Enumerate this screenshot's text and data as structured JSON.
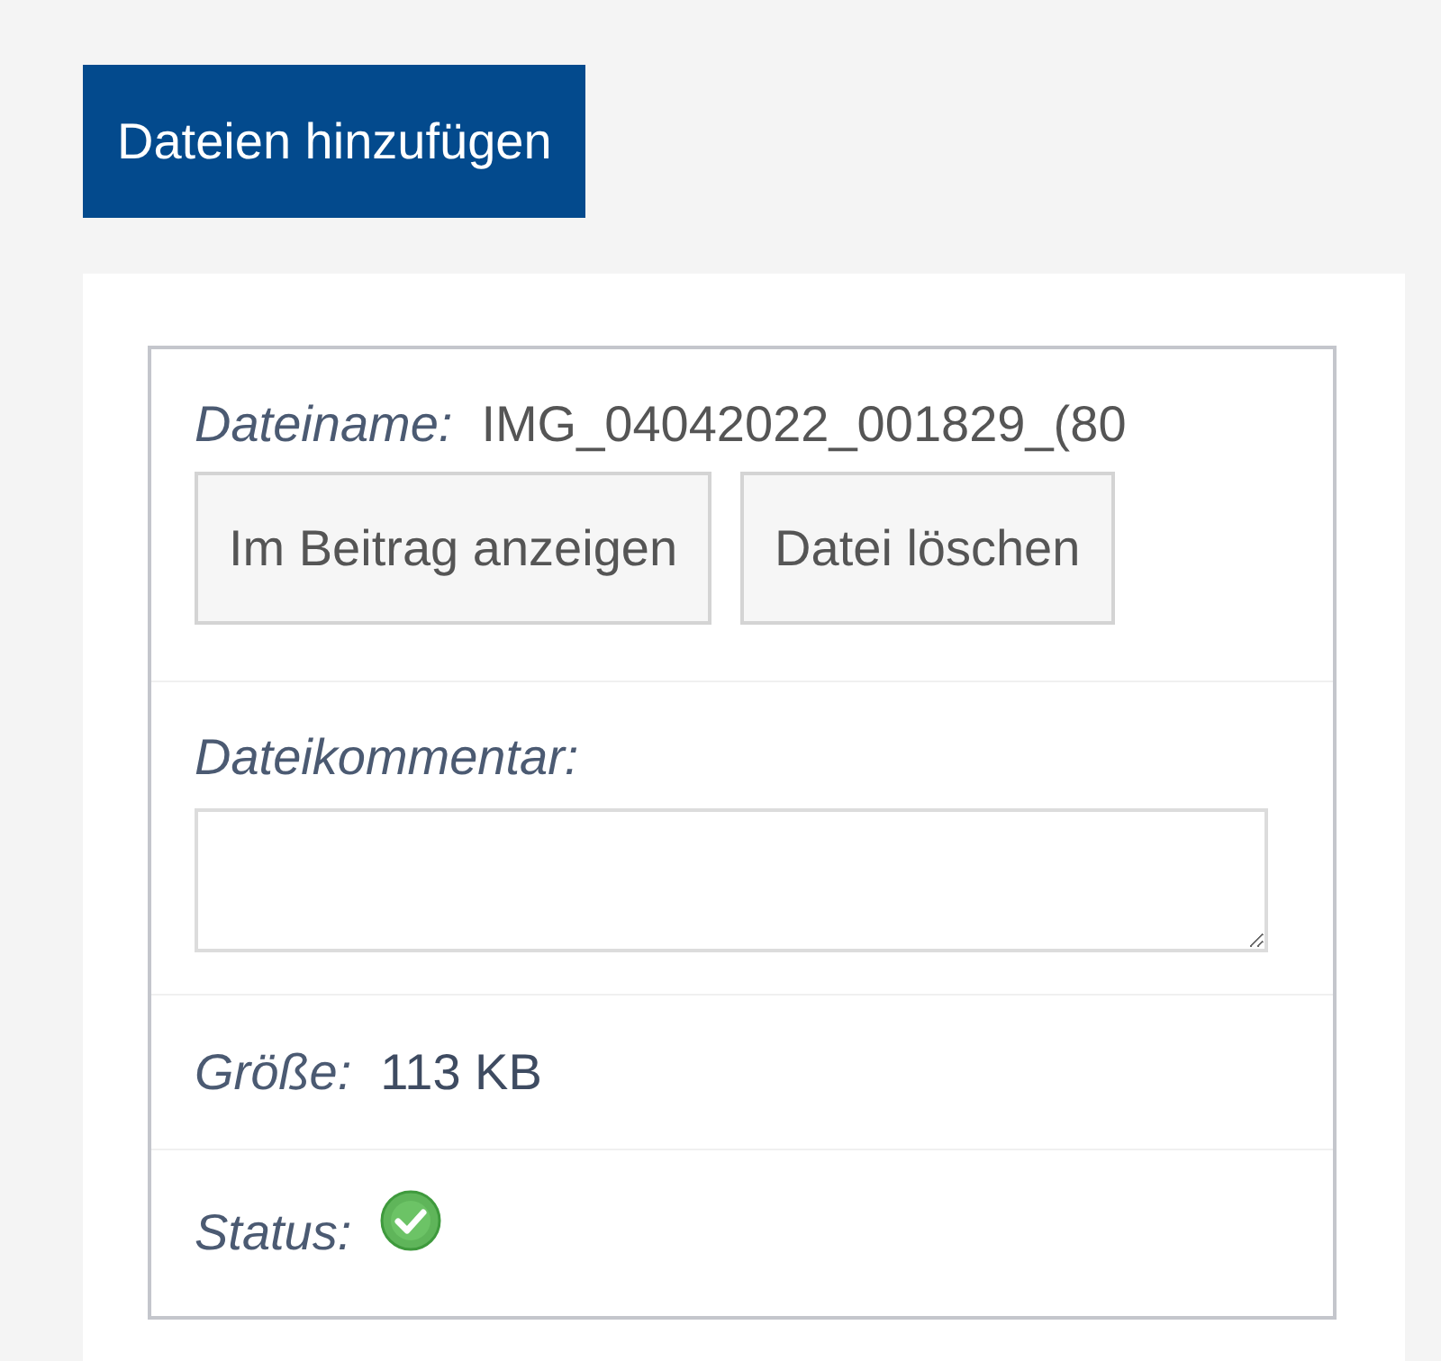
{
  "add_button": {
    "label": "Dateien hinzufügen"
  },
  "file": {
    "name_label": "Dateiname:",
    "name": "IMG_04042022_001829_(80",
    "buttons": [
      {
        "label": "Im Beitrag anzeigen"
      },
      {
        "label": "Datei löschen"
      }
    ],
    "comment_label": "Dateikommentar:",
    "size_label": "Größe:",
    "size": "113 KB",
    "status_label": "Status:",
    "uploaded": true
  }
}
